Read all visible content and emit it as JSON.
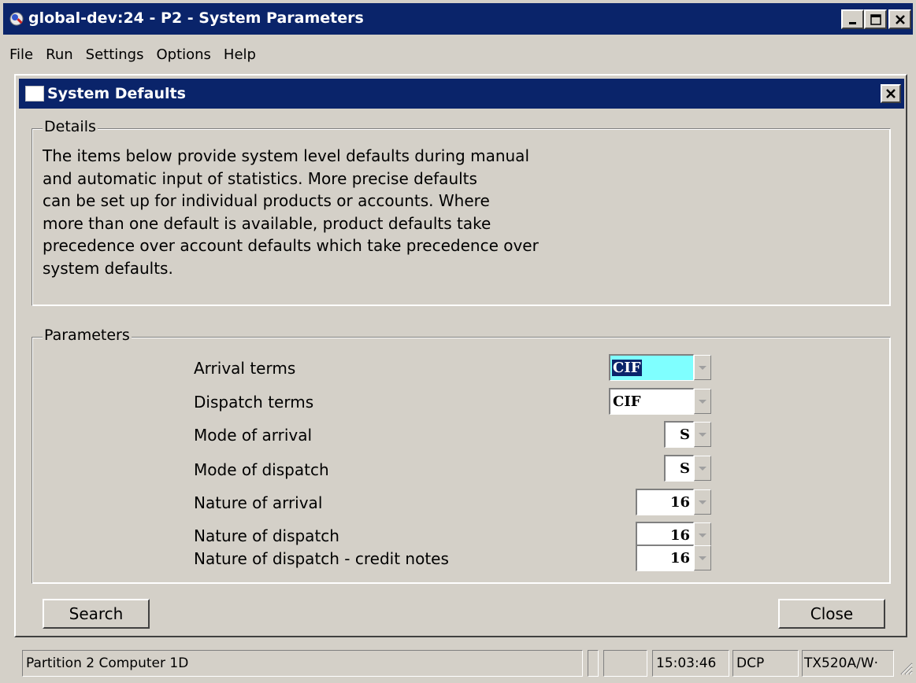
{
  "window": {
    "title": "global-dev:24 - P2 - System Parameters"
  },
  "menu": [
    "File",
    "Run",
    "Settings",
    "Options",
    "Help"
  ],
  "dialog": {
    "title": "System Defaults",
    "details_label": "Details",
    "details_lines": [
      "The items below provide system level defaults during manual",
      "and automatic input of statistics.  More precise defaults",
      "can be set up for individual products or accounts.  Where",
      "more than one default is available, product defaults take",
      "precedence over account defaults which take precedence over",
      "system defaults."
    ],
    "parameters_label": "Parameters",
    "parameters": [
      {
        "label": "Arrival terms",
        "value": "CIF"
      },
      {
        "label": "Dispatch terms",
        "value": "CIF"
      },
      {
        "label": "Mode of arrival",
        "value": "S"
      },
      {
        "label": "Mode of dispatch",
        "value": "S"
      },
      {
        "label": "Nature of arrival",
        "value": "16"
      },
      {
        "label": "Nature of dispatch",
        "value": "16"
      },
      {
        "label": "Nature of dispatch - credit notes",
        "value": "16"
      }
    ],
    "search_label": "Search",
    "close_label": "Close"
  },
  "status": {
    "left": "Partition 2 Computer 1D",
    "time": "15:03:46",
    "mode": "DCP",
    "program": "TX520A/W·"
  },
  "colors": {
    "title_bar": "#0a246a",
    "selection_bg": "#7fffff",
    "face": "#d4d0c8"
  }
}
